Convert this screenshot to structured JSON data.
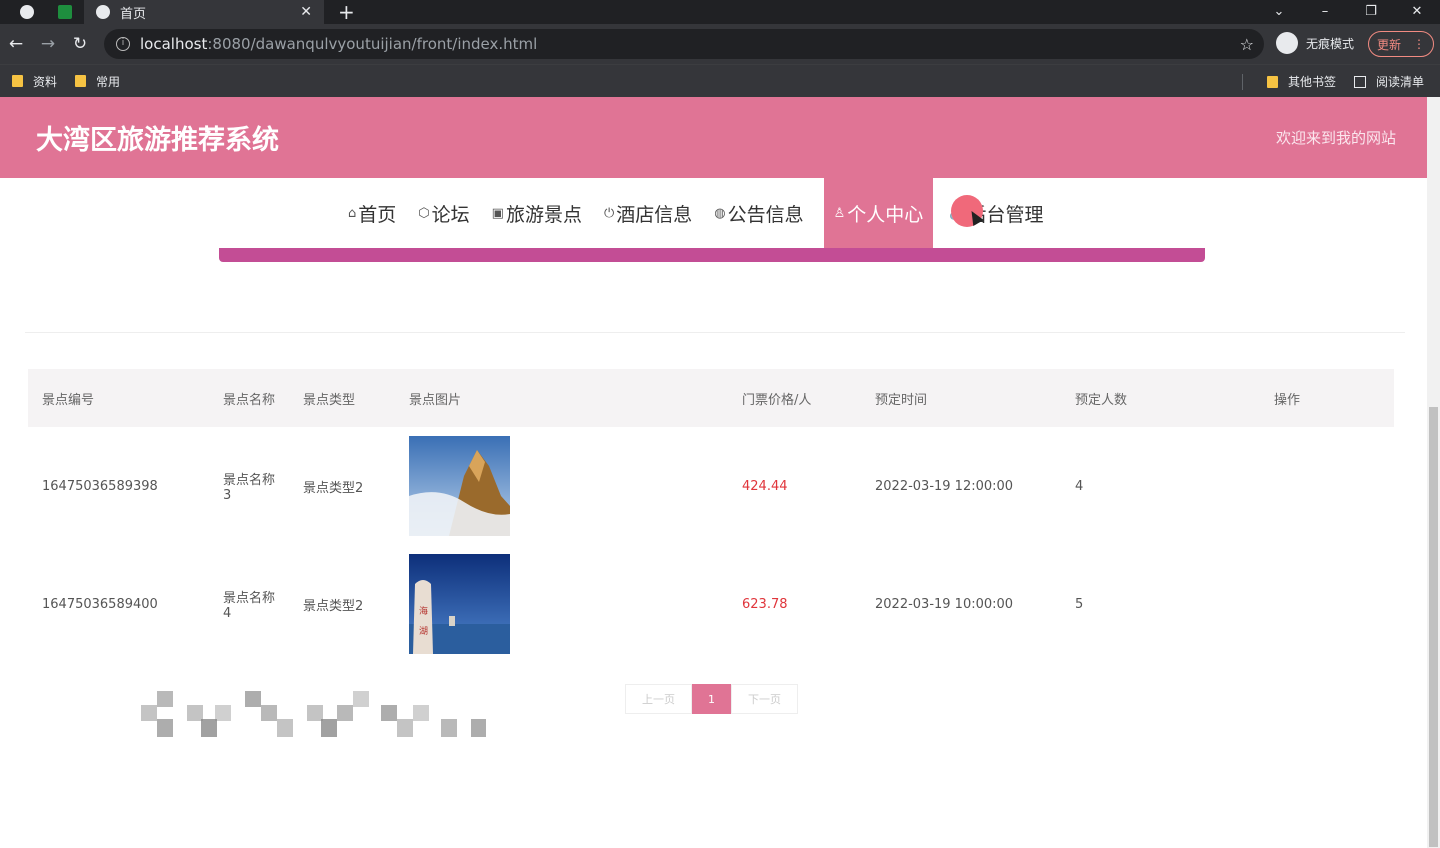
{
  "browser": {
    "tab_title": "首页",
    "url_host": "localhost",
    "url_path": ":8080/dawanqulvyoutuijian/front/index.html",
    "incognito_label": "无痕模式",
    "update_label": "更新",
    "bookmarks": [
      "资料",
      "常用"
    ],
    "other_bookmarks": "其他书签",
    "reading_list": "阅读清单"
  },
  "site": {
    "title": "大湾区旅游推荐系统",
    "welcome": "欢迎来到我的网站",
    "nav": [
      {
        "icon": "home-icon",
        "glyph": "⌂",
        "label": "首页"
      },
      {
        "icon": "cube-icon",
        "glyph": "⬡",
        "label": "论坛"
      },
      {
        "icon": "gift-icon",
        "glyph": "▣",
        "label": "旅游景点"
      },
      {
        "icon": "power-icon",
        "glyph": "⏻",
        "label": "酒店信息"
      },
      {
        "icon": "globe-icon",
        "glyph": "◍",
        "label": "公告信息"
      },
      {
        "icon": "user-icon",
        "glyph": "♙",
        "label": "个人中心",
        "active": true
      },
      {
        "icon": "link-icon",
        "glyph": "🔗",
        "label": "后台管理"
      }
    ]
  },
  "table": {
    "headers": [
      "景点编号",
      "景点名称",
      "景点类型",
      "景点图片",
      "门票价格/人",
      "预定时间",
      "预定人数",
      "操作"
    ],
    "rows": [
      {
        "id": "16475036589398",
        "name": "景点名称3",
        "type": "景点类型2",
        "image": "mountain-cloud-photo",
        "price": "424.44",
        "time": "2022-03-19 12:00:00",
        "count": "4",
        "op": ""
      },
      {
        "id": "16475036589400",
        "name": "景点名称4",
        "type": "景点类型2",
        "image": "seaside-rock-photo",
        "price": "623.78",
        "time": "2022-03-19 10:00:00",
        "count": "5",
        "op": ""
      }
    ]
  },
  "pager": {
    "prev": "上一页",
    "current": "1",
    "next": "下一页"
  },
  "colors": {
    "brand": "#e07495",
    "banner": "#c34d95",
    "price": "#e0353b"
  }
}
